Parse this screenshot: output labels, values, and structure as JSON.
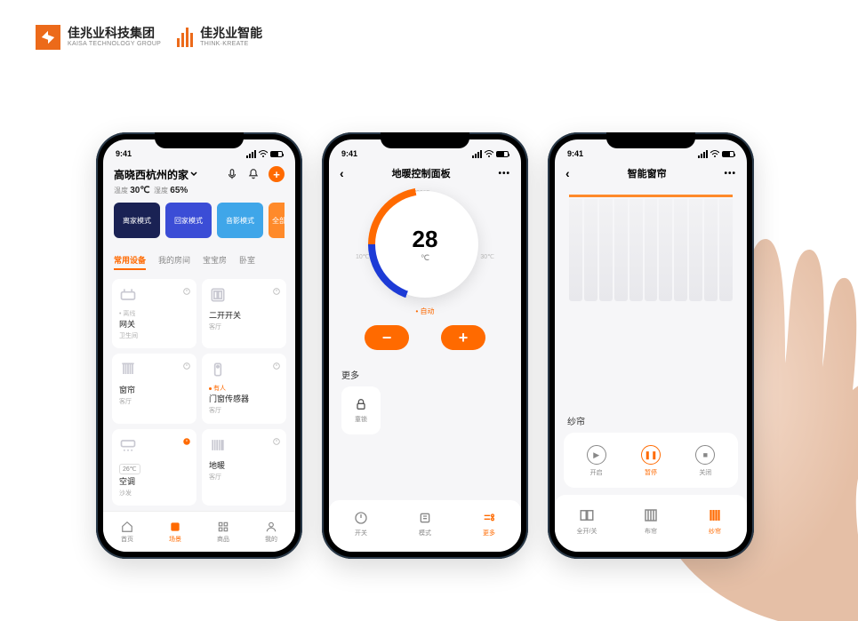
{
  "brand": {
    "group_cn": "佳兆业科技集团",
    "group_en": "KAISA TECHNOLOGY GROUP",
    "sub_cn": "佳兆业智能",
    "sub_en": "THINK·KREATE"
  },
  "status_time": "9:41",
  "colors": {
    "accent": "#ff6a00"
  },
  "phone1": {
    "home_name": "高晓西杭州的家",
    "env": {
      "temp_label": "温度",
      "temp_val": "30℃",
      "hum_label": "湿度",
      "hum_val": "65%"
    },
    "modes": [
      "离家模式",
      "回家模式",
      "音影模式",
      "全部"
    ],
    "tabs": [
      "常用设备",
      "我的房间",
      "宝宝房",
      "卧室"
    ],
    "active_tab": 0,
    "devices": [
      {
        "name": "网关",
        "sub": "卫生间",
        "extra": "• 离线",
        "power": false,
        "icon": "router"
      },
      {
        "name": "二开开关",
        "sub": "客厅",
        "power": false,
        "icon": "switch"
      },
      {
        "name": "窗帘",
        "sub": "客厅",
        "power": false,
        "icon": "curtain"
      },
      {
        "name": "门窗传感器",
        "sub": "客厅",
        "tag": "有人",
        "power": false,
        "icon": "sensor"
      },
      {
        "name": "空调",
        "sub": "沙发",
        "badge": "26℃",
        "power": true,
        "icon": "ac"
      },
      {
        "name": "地暖",
        "sub": "客厅",
        "power": false,
        "icon": "heat"
      }
    ],
    "nav": [
      {
        "label": "首页",
        "icon": "home"
      },
      {
        "label": "场景",
        "icon": "scene"
      },
      {
        "label": "商品",
        "icon": "grid"
      },
      {
        "label": "我的",
        "icon": "user"
      }
    ],
    "active_nav": 1
  },
  "phone2": {
    "title": "地暖控制面板",
    "dial": {
      "value": "28",
      "unit": "℃",
      "min": "10℃",
      "mid": "20℃",
      "max": "30℃"
    },
    "mode_label": "自动",
    "more_label": "更多",
    "lock_label": "童锁",
    "bottom": [
      {
        "label": "开关",
        "icon": "power"
      },
      {
        "label": "模式",
        "icon": "mode"
      },
      {
        "label": "更多",
        "icon": "settings"
      }
    ],
    "active_bottom": 2
  },
  "phone3": {
    "title": "智能窗帘",
    "section_label": "纱帘",
    "controls": [
      {
        "label": "开启",
        "icon": "play"
      },
      {
        "label": "暂停",
        "icon": "pause"
      },
      {
        "label": "关闭",
        "icon": "stop"
      }
    ],
    "active_control": 1,
    "bottom": [
      {
        "label": "全开/关",
        "icon": "full"
      },
      {
        "label": "布帘",
        "icon": "cloth"
      },
      {
        "label": "纱帘",
        "icon": "sheer"
      }
    ],
    "active_bottom": 2
  }
}
